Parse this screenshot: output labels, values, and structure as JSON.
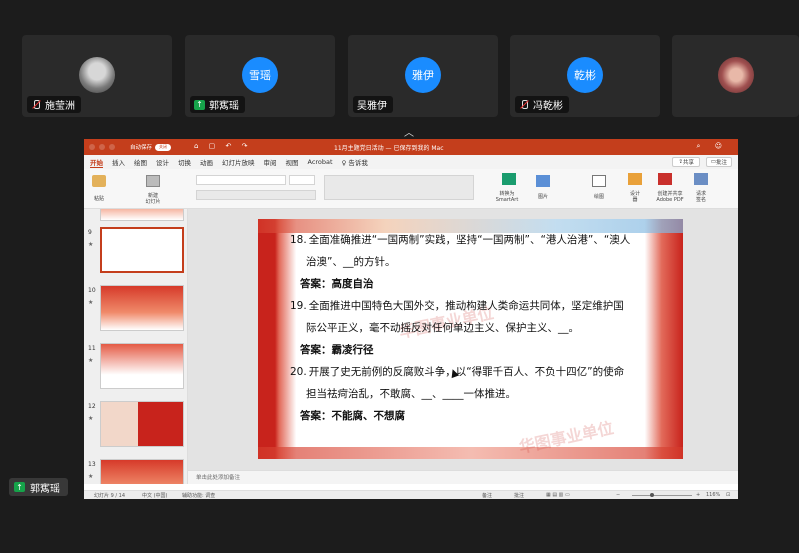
{
  "participants": [
    {
      "name": "施莹洲",
      "avatar_text": "",
      "kind": "photo",
      "status": "muted"
    },
    {
      "name": "郭寯瑶",
      "avatar_text": "雪瑶",
      "kind": "initials",
      "status": "sharing"
    },
    {
      "name": "吴雅伊",
      "avatar_text": "雅伊",
      "kind": "initials",
      "status": "none"
    },
    {
      "name": "冯乾彬",
      "avatar_text": "乾彬",
      "kind": "initials",
      "status": "muted"
    },
    {
      "name": "",
      "avatar_text": "",
      "kind": "photo2",
      "status": "none"
    }
  ],
  "self_name": "郭寯瑶",
  "ppt": {
    "autosave_label": "自动保存",
    "autosave_toggle": "关闭",
    "doc_title": "11月主题党日活动 — 已保存到我的 Mac",
    "tabs": [
      "开始",
      "插入",
      "绘图",
      "设计",
      "切换",
      "动画",
      "幻灯片放映",
      "审阅",
      "视图",
      "Acrobat",
      "告诉我"
    ],
    "share_label": "共享",
    "comment_label": "批注",
    "ribbon_labels": {
      "paste": "粘贴",
      "new_slide": "新建\n幻灯片",
      "smartart": "转换为\nSmartArt",
      "picture": "图片",
      "shapes": "绘图",
      "designer": "设计\n器",
      "adobe": "创建并共享\nAdobe PDF",
      "request_sign": "请求\n签名"
    },
    "thumb_numbers": [
      "9",
      "10",
      "11",
      "12",
      "13"
    ],
    "notes_placeholder": "单击此处添加备注",
    "status": {
      "slide_pos": "幻灯片 9 / 14",
      "lang": "中文 (中国)",
      "accessibility": "辅助功能: 调查",
      "notes_btn": "备注",
      "comments_btn": "批注",
      "zoom": "116%"
    }
  },
  "slide": {
    "items": [
      {
        "type": "q",
        "num": "18.",
        "line1": "全面准确推进“一国两制”实践，坚持“一国两制”、“港人治港”、“澳人",
        "line2": "治澳”、__的方针。"
      },
      {
        "type": "a",
        "text": "答案：高度自治"
      },
      {
        "type": "q",
        "num": "19.",
        "line1": "全面推进中国特色大国外交，推动构建人类命运共同体，坚定维护国",
        "line2": "际公平正义，毫不动摇反对任何单边主义、保护主义、__。"
      },
      {
        "type": "a",
        "text": "答案：霸凌行径"
      },
      {
        "type": "q",
        "num": "20.",
        "line1": "开展了史无前例的反腐败斗争，以“得罪千百人、不负十四亿”的使命",
        "line2": "担当祛疴治乱，不敢腐、__、____一体推进。"
      },
      {
        "type": "a",
        "text": "答案：不能腐、不想腐"
      }
    ],
    "watermark": "华图事业单位"
  },
  "colors": {
    "ppt_accent": "#c43e1c",
    "avatar_blue": "#1a8cff",
    "share_green": "#16a34a"
  }
}
